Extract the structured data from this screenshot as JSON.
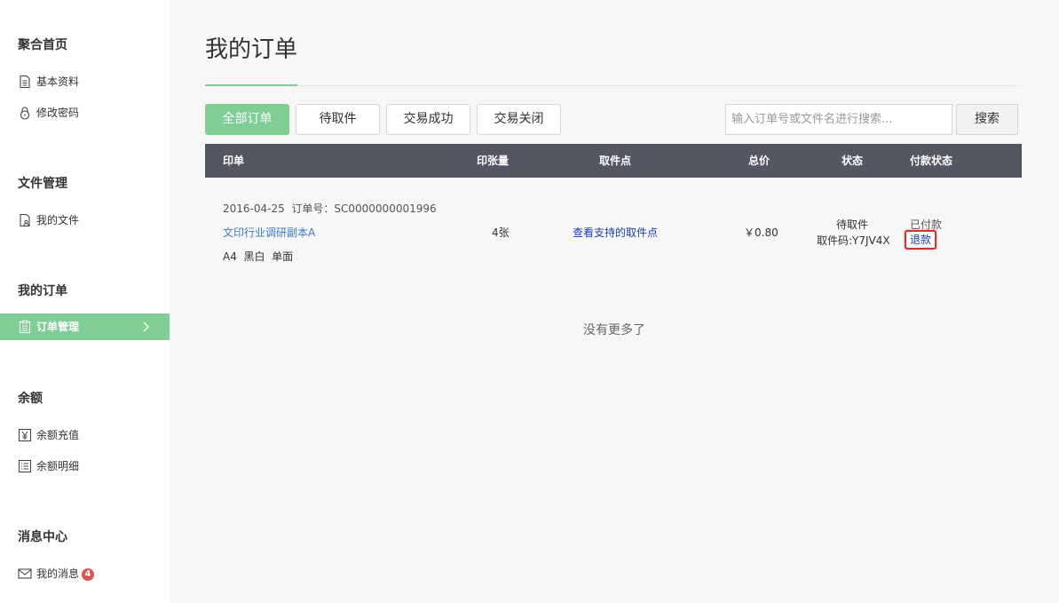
{
  "sidebar": {
    "sections": [
      {
        "title": "聚合首页",
        "items": [
          {
            "label": "基本资料",
            "icon": "document-icon"
          },
          {
            "label": "修改密码",
            "icon": "lock-icon"
          }
        ]
      },
      {
        "title": "文件管理",
        "items": [
          {
            "label": "我的文件",
            "icon": "file-user-icon"
          }
        ]
      },
      {
        "title": "我的订单",
        "items": [
          {
            "label": "订单管理",
            "icon": "clipboard-icon",
            "active": true
          }
        ]
      },
      {
        "title": "余额",
        "items": [
          {
            "label": "余额充值",
            "icon": "yen-icon"
          },
          {
            "label": "余额明细",
            "icon": "list-icon"
          }
        ]
      },
      {
        "title": "消息中心",
        "items": [
          {
            "label": "我的消息",
            "icon": "mail-icon",
            "badge": "4"
          }
        ]
      }
    ]
  },
  "main": {
    "title": "我的订单",
    "tabs": [
      {
        "label": "全部订单",
        "active": true
      },
      {
        "label": "待取件"
      },
      {
        "label": "交易成功"
      },
      {
        "label": "交易关闭"
      }
    ],
    "search": {
      "placeholder": "输入订单号或文件名进行搜索...",
      "value": "",
      "button_label": "搜索"
    },
    "table": {
      "columns": [
        "印单",
        "印张量",
        "取件点",
        "总价",
        "状态",
        "付款状态"
      ],
      "rows": [
        {
          "date": "2016-04-25",
          "order_label": "订单号：SC0000000001996",
          "doc_name": "文印行业调研副本A",
          "spec": "A4  黑白  单面",
          "quantity": "4张",
          "pickup_link": "查看支持的取件点",
          "price": "￥0.80",
          "status": "待取件",
          "pickup_code": "取件码:Y7JV4X",
          "pay_status": "已付款",
          "refund_label": "退款"
        }
      ]
    },
    "no_more": "没有更多了"
  },
  "colors": {
    "accent": "#7fce96",
    "table_header": "#545663",
    "link": "#3a7bc8",
    "badge": "#e0524e",
    "highlight_border": "#d2332e"
  }
}
